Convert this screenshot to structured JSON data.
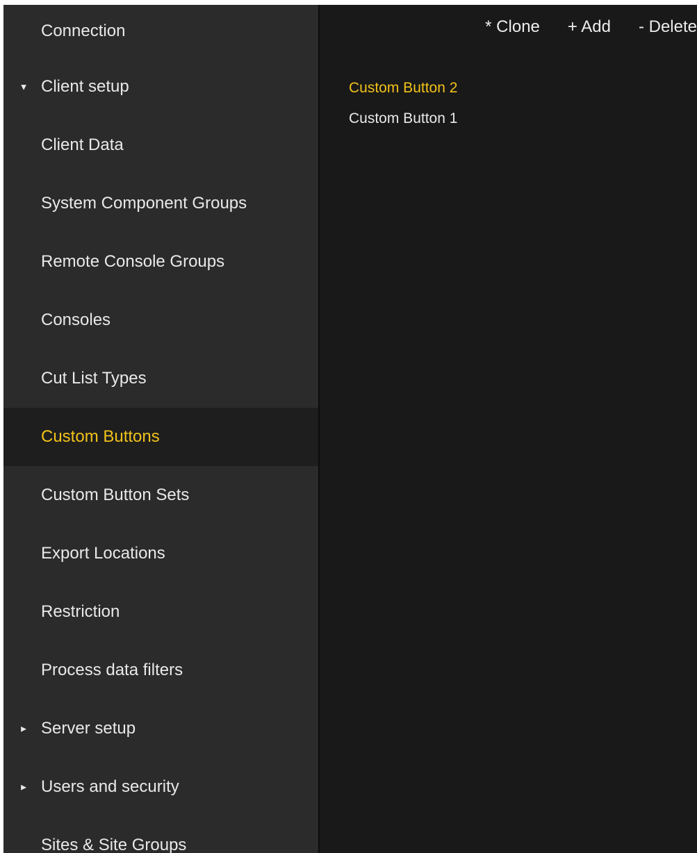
{
  "sidebar": {
    "items": [
      {
        "label": "Connection"
      },
      {
        "label": "Client setup",
        "caret": "▼"
      },
      {
        "label": "Client Data"
      },
      {
        "label": "System Component Groups"
      },
      {
        "label": "Remote Console Groups"
      },
      {
        "label": "Consoles"
      },
      {
        "label": "Cut List Types"
      },
      {
        "label": "Custom Buttons",
        "active": true
      },
      {
        "label": "Custom Button Sets"
      },
      {
        "label": "Export Locations"
      },
      {
        "label": "Restriction"
      },
      {
        "label": "Process data filters"
      },
      {
        "label": "Server setup",
        "caret": "►"
      },
      {
        "label": "Users and security",
        "caret": "►"
      },
      {
        "label": "Sites & Site Groups"
      }
    ]
  },
  "toolbar": {
    "clone_label": "* Clone",
    "add_label": "+ Add",
    "delete_label": "- Delete"
  },
  "list": {
    "items": [
      {
        "label": "Custom Button 2",
        "selected": true
      },
      {
        "label": "Custom Button 1",
        "selected": false
      }
    ]
  },
  "colors": {
    "accent": "#f2c21b",
    "sidebar_bg": "#2b2b2b",
    "main_bg": "#191919",
    "active_bg": "#1e1e1e",
    "text": "#e9e9e9"
  }
}
